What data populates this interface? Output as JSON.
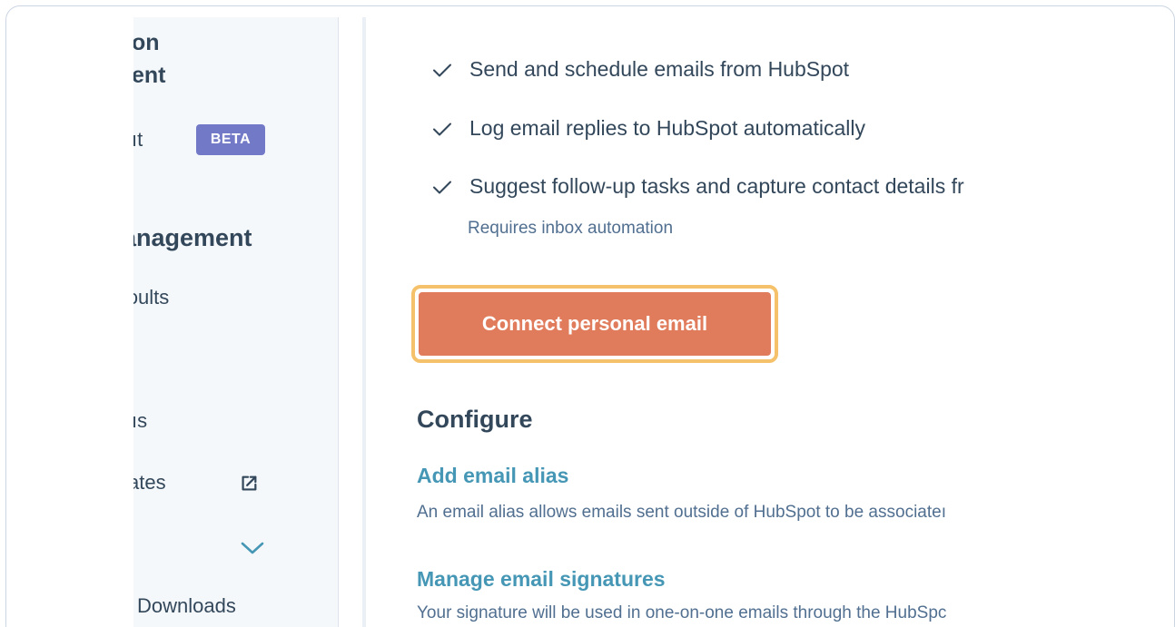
{
  "sidebar": {
    "title_line1": "on",
    "title_line2": "ent",
    "item_account_fragment": "ıt",
    "beta_badge": "BETA",
    "section_heading": "anagement",
    "item_defaults_fragment": "ɔults",
    "item_ns_fragment": "ıs",
    "item_updates_fragment": "ates",
    "item_downloads": "Downloads"
  },
  "main": {
    "features": [
      {
        "text": "Send and schedule emails from HubSpot"
      },
      {
        "text": "Log email replies to HubSpot automatically"
      },
      {
        "text": "Suggest follow-up tasks and capture contact details fr"
      }
    ],
    "feature_note": "Requires inbox automation",
    "connect_button": "Connect personal email",
    "configure_heading": "Configure",
    "alias_link": "Add email alias",
    "alias_desc": "An email alias allows emails sent outside of HubSpot to be associateı",
    "signatures_link": "Manage email signatures",
    "signatures_desc": "Your signature will be used in one-on-one emails through the HubSpc"
  },
  "colors": {
    "accent_button": "#e07c5c",
    "focus_ring": "#f5c26b",
    "link": "#4597b5",
    "beta_badge": "#7279c6",
    "text": "#33475b"
  },
  "icons": {
    "check": "check-icon",
    "external": "external-link-icon",
    "chevron": "chevron-down-icon"
  }
}
